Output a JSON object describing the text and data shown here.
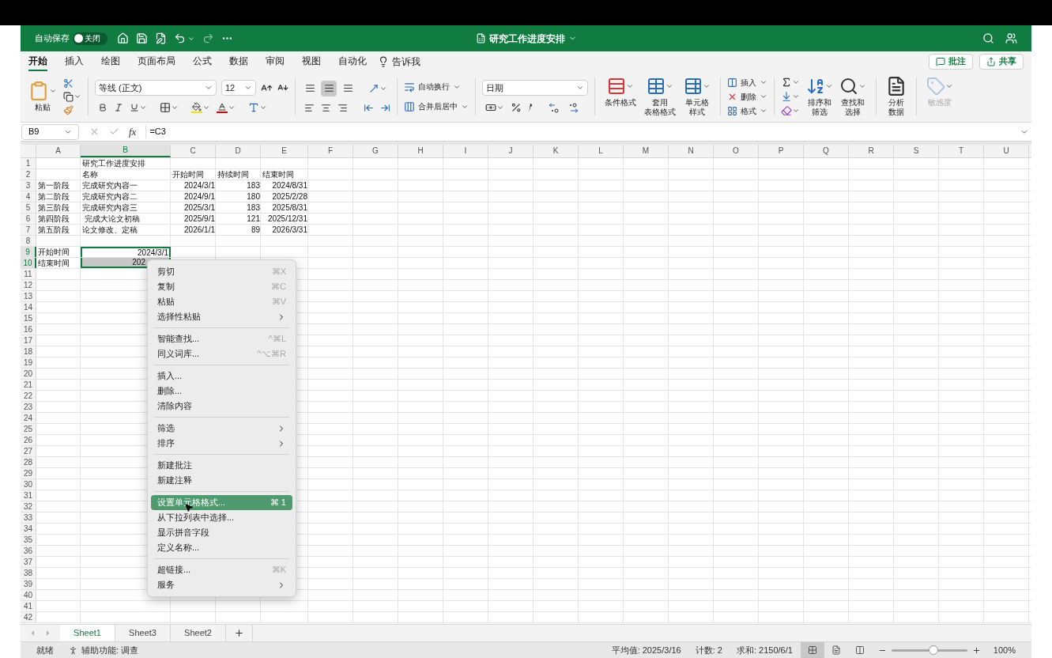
{
  "title_bar": {
    "autosave": {
      "label": "自动保存",
      "on": false,
      "state_text": "关闭"
    },
    "title": "研究工作进度安排"
  },
  "ribbon_tabs": [
    {
      "label": "开始",
      "selected": true
    },
    {
      "label": "插入",
      "selected": false
    },
    {
      "label": "绘图",
      "selected": false
    },
    {
      "label": "页面布局",
      "selected": false
    },
    {
      "label": "公式",
      "selected": false
    },
    {
      "label": "数据",
      "selected": false
    },
    {
      "label": "审阅",
      "selected": false
    },
    {
      "label": "视图",
      "selected": false
    },
    {
      "label": "自动化",
      "selected": false
    }
  ],
  "tell_me": "告诉我",
  "comments_button": "批注",
  "share_button": "共享",
  "ribbon": {
    "paste_label": "粘贴",
    "font_name": "等线 (正文)",
    "font_size": "12",
    "vertical_align": [
      {
        "selected": false
      },
      {
        "selected": true
      },
      {
        "selected": false
      }
    ],
    "wrap_text": "自动换行",
    "merge_center": "合并后居中",
    "number_format": "日期",
    "styles": [
      {
        "lines": [
          "条件格式"
        ]
      },
      {
        "lines": [
          "套用",
          "表格格式"
        ]
      },
      {
        "lines": [
          "单元格",
          "样式"
        ]
      }
    ],
    "cells": [
      "插入",
      "删除",
      "格式"
    ],
    "editing": [
      {
        "lines": [
          "排序和",
          "筛选"
        ]
      },
      {
        "lines": [
          "查找和",
          "选择"
        ]
      }
    ],
    "analyze": {
      "lines": [
        "分析",
        "数据"
      ]
    },
    "sensitivity": {
      "label": "敏感度",
      "disabled": true
    }
  },
  "formula_bar": {
    "name_box": "B9",
    "fx": "fx",
    "formula": "=C3"
  },
  "columns": [
    {
      "label": "A",
      "selected": false
    },
    {
      "label": "B",
      "selected": true
    },
    {
      "label": "C",
      "selected": false
    },
    {
      "label": "D",
      "selected": false
    },
    {
      "label": "E",
      "selected": false
    },
    {
      "label": "F",
      "selected": false
    },
    {
      "label": "G",
      "selected": false
    },
    {
      "label": "H",
      "selected": false
    },
    {
      "label": "I",
      "selected": false
    },
    {
      "label": "J",
      "selected": false
    },
    {
      "label": "K",
      "selected": false
    },
    {
      "label": "L",
      "selected": false
    },
    {
      "label": "M",
      "selected": false
    },
    {
      "label": "N",
      "selected": false
    },
    {
      "label": "O",
      "selected": false
    },
    {
      "label": "P",
      "selected": false
    },
    {
      "label": "Q",
      "selected": false
    },
    {
      "label": "R",
      "selected": false
    },
    {
      "label": "S",
      "selected": false
    },
    {
      "label": "T",
      "selected": false
    },
    {
      "label": "U",
      "selected": false
    }
  ],
  "rows": [
    {
      "number": "1",
      "selected": false,
      "cells": {
        "b": {
          "text": "研究工作进度安排",
          "kind": "text"
        }
      }
    },
    {
      "number": "2",
      "selected": false,
      "cells": {
        "b": {
          "text": "名称",
          "kind": "text"
        },
        "c": {
          "text": "开始时间",
          "kind": "text"
        },
        "d": {
          "text": "持续时间",
          "kind": "text"
        },
        "e": {
          "text": "结束时间",
          "kind": "text"
        }
      }
    },
    {
      "number": "3",
      "selected": false,
      "cells": {
        "a": {
          "text": "第一阶段",
          "kind": "text"
        },
        "b": {
          "text": "完成研究内容一",
          "kind": "text"
        },
        "c": {
          "text": "2024/3/1",
          "kind": "number"
        },
        "d": {
          "text": "183",
          "kind": "number"
        },
        "e": {
          "text": "2024/8/31",
          "kind": "number"
        }
      }
    },
    {
      "number": "4",
      "selected": false,
      "cells": {
        "a": {
          "text": "第二阶段",
          "kind": "text"
        },
        "b": {
          "text": "完成研究内容二",
          "kind": "text"
        },
        "c": {
          "text": "2024/9/1",
          "kind": "number"
        },
        "d": {
          "text": "180",
          "kind": "number"
        },
        "e": {
          "text": "2025/2/28",
          "kind": "number"
        }
      }
    },
    {
      "number": "5",
      "selected": false,
      "cells": {
        "a": {
          "text": "第三阶段",
          "kind": "text"
        },
        "b": {
          "text": "完成研究内容三",
          "kind": "text"
        },
        "c": {
          "text": "2025/3/1",
          "kind": "number"
        },
        "d": {
          "text": "183",
          "kind": "number"
        },
        "e": {
          "text": "2025/8/31",
          "kind": "number"
        }
      }
    },
    {
      "number": "6",
      "selected": false,
      "cells": {
        "a": {
          "text": "第四阶段",
          "kind": "text"
        },
        "b": {
          "text": " 完成大论文初稿",
          "kind": "text"
        },
        "c": {
          "text": "2025/9/1",
          "kind": "number"
        },
        "d": {
          "text": "121",
          "kind": "number"
        },
        "e": {
          "text": "2025/12/31",
          "kind": "number"
        }
      }
    },
    {
      "number": "7",
      "selected": false,
      "cells": {
        "a": {
          "text": "第五阶段",
          "kind": "text"
        },
        "b": {
          "text": "论文修改、定稿",
          "kind": "text"
        },
        "c": {
          "text": "2026/1/1",
          "kind": "number"
        },
        "d": {
          "text": "89",
          "kind": "number"
        },
        "e": {
          "text": "2026/3/31",
          "kind": "number"
        }
      }
    },
    {
      "number": "8",
      "selected": false,
      "cells": {}
    },
    {
      "number": "9",
      "selected": true,
      "cells": {
        "a": {
          "text": "开始时间",
          "kind": "text"
        },
        "b": {
          "text": "2024/3/1",
          "kind": "number",
          "active": true
        }
      }
    },
    {
      "number": "10",
      "selected": true,
      "cells": {
        "a": {
          "text": "结束时间",
          "kind": "text"
        },
        "b": {
          "text": "202",
          "kind": "number",
          "active": false,
          "covered": true
        }
      }
    },
    {
      "number": "11",
      "selected": false,
      "cells": {}
    },
    {
      "number": "12",
      "selected": false,
      "cells": {}
    },
    {
      "number": "13",
      "selected": false,
      "cells": {}
    },
    {
      "number": "14",
      "selected": false,
      "cells": {}
    },
    {
      "number": "15",
      "selected": false,
      "cells": {}
    },
    {
      "number": "16",
      "selected": false,
      "cells": {}
    },
    {
      "number": "17",
      "selected": false,
      "cells": {}
    },
    {
      "number": "18",
      "selected": false,
      "cells": {}
    },
    {
      "number": "19",
      "selected": false,
      "cells": {}
    },
    {
      "number": "20",
      "selected": false,
      "cells": {}
    },
    {
      "number": "21",
      "selected": false,
      "cells": {}
    },
    {
      "number": "22",
      "selected": false,
      "cells": {}
    },
    {
      "number": "23",
      "selected": false,
      "cells": {}
    },
    {
      "number": "24",
      "selected": false,
      "cells": {}
    },
    {
      "number": "25",
      "selected": false,
      "cells": {}
    },
    {
      "number": "26",
      "selected": false,
      "cells": {}
    },
    {
      "number": "27",
      "selected": false,
      "cells": {}
    },
    {
      "number": "28",
      "selected": false,
      "cells": {}
    },
    {
      "number": "29",
      "selected": false,
      "cells": {}
    },
    {
      "number": "30",
      "selected": false,
      "cells": {}
    },
    {
      "number": "31",
      "selected": false,
      "cells": {}
    },
    {
      "number": "32",
      "selected": false,
      "cells": {}
    },
    {
      "number": "33",
      "selected": false,
      "cells": {}
    },
    {
      "number": "34",
      "selected": false,
      "cells": {}
    },
    {
      "number": "35",
      "selected": false,
      "cells": {}
    },
    {
      "number": "36",
      "selected": false,
      "cells": {}
    },
    {
      "number": "37",
      "selected": false,
      "cells": {}
    },
    {
      "number": "38",
      "selected": false,
      "cells": {}
    },
    {
      "number": "39",
      "selected": false,
      "cells": {}
    },
    {
      "number": "40",
      "selected": false,
      "cells": {}
    },
    {
      "number": "41",
      "selected": false,
      "cells": {}
    },
    {
      "number": "42",
      "selected": false,
      "cells": {}
    }
  ],
  "context_menu": [
    {
      "kind": "item",
      "label": "剪切",
      "shortcut": "⌘X",
      "selected": false
    },
    {
      "kind": "item",
      "label": "复制",
      "shortcut": "⌘C",
      "selected": false
    },
    {
      "kind": "item",
      "label": "粘贴",
      "shortcut": "⌘V",
      "selected": false
    },
    {
      "kind": "submenu",
      "label": "选择性粘贴",
      "selected": false
    },
    {
      "kind": "separator"
    },
    {
      "kind": "item",
      "label": "智能查找...",
      "shortcut": "^⌘L",
      "selected": false
    },
    {
      "kind": "item",
      "label": "同义词库...",
      "shortcut": "^⌥⌘R",
      "selected": false
    },
    {
      "kind": "separator"
    },
    {
      "kind": "item",
      "label": "插入...",
      "selected": false
    },
    {
      "kind": "item",
      "label": "删除...",
      "selected": false
    },
    {
      "kind": "item",
      "label": "清除内容",
      "selected": false
    },
    {
      "kind": "separator"
    },
    {
      "kind": "submenu",
      "label": "筛选",
      "selected": false
    },
    {
      "kind": "submenu",
      "label": "排序",
      "selected": false
    },
    {
      "kind": "separator"
    },
    {
      "kind": "item",
      "label": "新建批注",
      "selected": false
    },
    {
      "kind": "item",
      "label": "新建注释",
      "selected": false
    },
    {
      "kind": "separator"
    },
    {
      "kind": "item",
      "label": "设置单元格格式...",
      "shortcut": "⌘ 1",
      "selected": true
    },
    {
      "kind": "item",
      "label": "从下拉列表中选择...",
      "selected": false
    },
    {
      "kind": "item",
      "label": "显示拼音字段",
      "selected": false
    },
    {
      "kind": "item",
      "label": "定义名称...",
      "selected": false
    },
    {
      "kind": "separator"
    },
    {
      "kind": "item",
      "label": "超链接...",
      "shortcut": "⌘K",
      "selected": false
    },
    {
      "kind": "submenu",
      "label": "服务",
      "selected": false
    }
  ],
  "sheet_tabs": [
    {
      "label": "Sheet1",
      "selected": true
    },
    {
      "label": "Sheet3",
      "selected": false
    },
    {
      "label": "Sheet2",
      "selected": false
    }
  ],
  "status_bar": {
    "ready": "就绪",
    "accessibility": "辅助功能: 调查",
    "average": "平均值: 2025/3/16",
    "count": "计数: 2",
    "sum": "求和: 2150/6/1",
    "views": [
      {
        "selected": true
      },
      {
        "selected": false
      },
      {
        "selected": false
      }
    ],
    "zoom": {
      "level": 0.55,
      "text": "100%"
    }
  }
}
